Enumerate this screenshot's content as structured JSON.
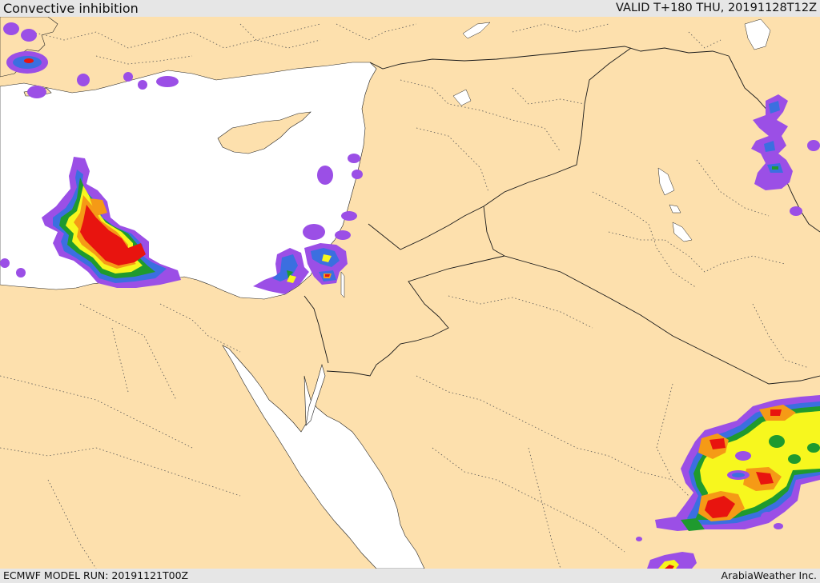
{
  "header": {
    "title": "Convective inhibition",
    "valid": "VALID T+180 THU, 20191128T12Z"
  },
  "footer": {
    "model_run": "ECMWF MODEL RUN: 20191121T00Z",
    "credit": "ArabiaWeather Inc."
  },
  "colors": {
    "land": "#fde0ad",
    "sea": "#ffffff",
    "border": "#1a1a1a",
    "province": "#555555",
    "purple": "#9b4fe6",
    "blue": "#3b6fe0",
    "green": "#1f9a2e",
    "yellow": "#f7f71e",
    "orange": "#f59a16",
    "red": "#e8140f"
  }
}
